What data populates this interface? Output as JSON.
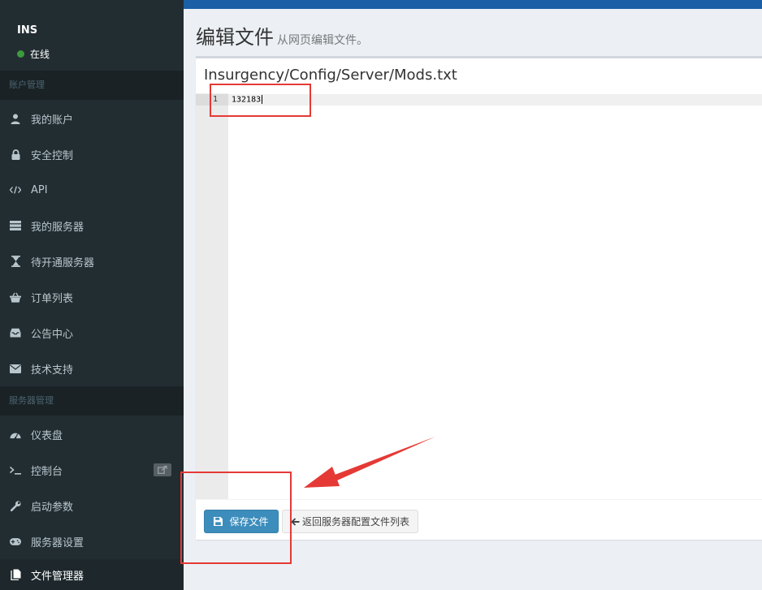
{
  "user": {
    "name": "INS",
    "status": "在线",
    "status_color": "#3c9b3c"
  },
  "sidebar": {
    "sections": [
      {
        "header": "账户管理",
        "items": [
          {
            "label": "我的账户",
            "icon": "user-icon"
          },
          {
            "label": "安全控制",
            "icon": "lock-icon"
          },
          {
            "label": "API",
            "icon": "code-icon"
          },
          {
            "label": "我的服务器",
            "icon": "server-icon"
          },
          {
            "label": "待开通服务器",
            "icon": "hourglass-icon"
          },
          {
            "label": "订单列表",
            "icon": "basket-icon"
          },
          {
            "label": "公告中心",
            "icon": "inbox-icon"
          },
          {
            "label": "技术支持",
            "icon": "envelope-icon"
          }
        ]
      },
      {
        "header": "服务器管理",
        "items": [
          {
            "label": "仪表盘",
            "icon": "dashboard-icon"
          },
          {
            "label": "控制台",
            "icon": "terminal-icon",
            "external": true
          },
          {
            "label": "启动参数",
            "icon": "wrench-icon"
          },
          {
            "label": "服务器设置",
            "icon": "gamepad-icon"
          },
          {
            "label": "文件管理器",
            "icon": "files-icon",
            "active": true
          }
        ]
      }
    ]
  },
  "page": {
    "title": "编辑文件",
    "subtitle": "从网页编辑文件。"
  },
  "editor": {
    "file_path": "Insurgency/Config/Server/Mods.txt",
    "lines": [
      {
        "number": "1",
        "text": "132183"
      }
    ]
  },
  "buttons": {
    "save_label": "保存文件",
    "back_label": "返回服务器配置文件列表"
  },
  "colors": {
    "sidebar_bg": "#222d32",
    "topbar": "#1b5fa6",
    "primary_button": "#3c8dbc",
    "annotation": "#e53935"
  }
}
